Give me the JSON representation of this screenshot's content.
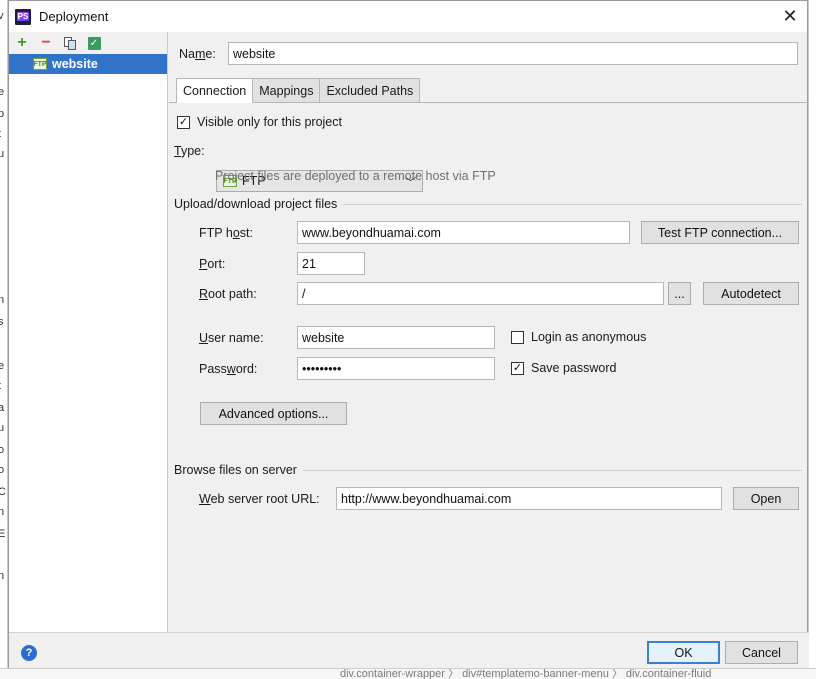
{
  "window": {
    "title": "Deployment",
    "close_icon": "close-icon"
  },
  "toolbar": {
    "add": "+",
    "remove": "−"
  },
  "servers": [
    {
      "name": "website",
      "badge": "FTP"
    }
  ],
  "name": {
    "label": "Name:",
    "value": "website"
  },
  "tabs": [
    {
      "label": "Connection",
      "active": true
    },
    {
      "label": "Mappings",
      "active": false
    },
    {
      "label": "Excluded Paths",
      "active": false
    }
  ],
  "visible_only": {
    "label": "Visible only for this project",
    "checked": true
  },
  "type": {
    "label": "Type:",
    "value": "FTP",
    "badge": "FTP",
    "hint": "Project files are deployed to a remote host via FTP"
  },
  "upload_section": {
    "title": "Upload/download project files"
  },
  "ftp_host": {
    "label": "FTP host:",
    "value": "www.beyondhuamai.com",
    "test_button": "Test FTP connection..."
  },
  "port": {
    "label": "Port:",
    "value": "21"
  },
  "root_path": {
    "label": "Root path:",
    "value": "/",
    "browse_button": "...",
    "autodetect_button": "Autodetect"
  },
  "user_name": {
    "label": "User name:",
    "value": "website",
    "anon_label": "Login as anonymous",
    "anon_checked": false
  },
  "password": {
    "label": "Password:",
    "value": "•••••••••",
    "save_label": "Save password",
    "save_checked": true
  },
  "advanced": {
    "label": "Advanced options..."
  },
  "browse_section": {
    "title": "Browse files on server"
  },
  "web_root": {
    "label": "Web server root URL:",
    "value": "http://www.beyondhuamai.com",
    "open_button": "Open"
  },
  "footer": {
    "ok": "OK",
    "cancel": "Cancel",
    "help": "?"
  },
  "background": {
    "breadcrumb": "div.container-wrapper  〉 div#templatemo-banner-menu  〉 div.container-fluid"
  }
}
